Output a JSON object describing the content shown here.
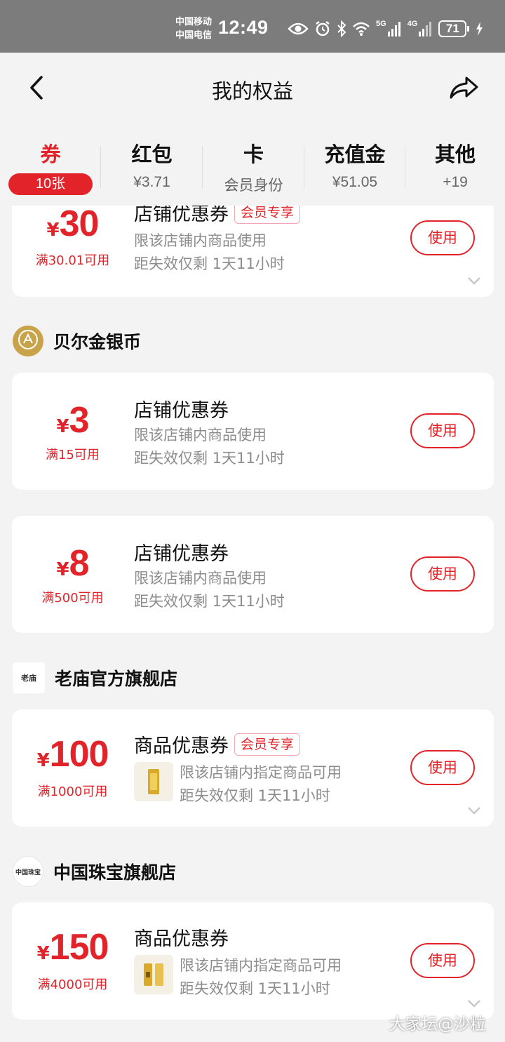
{
  "status_bar": {
    "carrier_1": "中国移动",
    "carrier_2": "中国电信",
    "time": "12:49",
    "signal_1": "5G",
    "signal_2": "4G",
    "battery": "71"
  },
  "header": {
    "title": "我的权益",
    "back_icon": "chevron-left-icon",
    "share_icon": "share-arrow-icon"
  },
  "tabs": [
    {
      "label": "券",
      "sub": "10张",
      "active": true
    },
    {
      "label": "红包",
      "sub": "¥3.71"
    },
    {
      "label": "卡",
      "sub": "会员身份"
    },
    {
      "label": "充值金",
      "sub": "¥51.05"
    },
    {
      "label": "其他",
      "sub": "+19"
    }
  ],
  "coupons": [
    {
      "yen": "¥",
      "amount": "30",
      "condition": "满30.01可用",
      "title": "店铺优惠券",
      "tag": "会员专享",
      "line1": "限该店铺内商品使用",
      "line2": "距失效仅剩 1天11小时",
      "button": "使用"
    },
    {
      "yen": "¥",
      "amount": "3",
      "condition": "满15可用",
      "title": "店铺优惠券",
      "line1": "限该店铺内商品使用",
      "line2": "距失效仅剩 1天11小时",
      "button": "使用"
    },
    {
      "yen": "¥",
      "amount": "8",
      "condition": "满500可用",
      "title": "店铺优惠券",
      "line1": "限该店铺内商品使用",
      "line2": "距失效仅剩 1天11小时",
      "button": "使用"
    },
    {
      "yen": "¥",
      "amount": "100",
      "condition": "满1000可用",
      "title": "商品优惠券",
      "tag": "会员专享",
      "line1": "限该店铺内指定商品可用",
      "line2": "距失效仅剩 1天11小时",
      "button": "使用"
    },
    {
      "yen": "¥",
      "amount": "150",
      "condition": "满4000可用",
      "title": "商品优惠券",
      "line1": "限该店铺内指定商品可用",
      "line2": "距失效仅剩 1天11小时",
      "button": "使用"
    }
  ],
  "stores": [
    {
      "name": "贝尔金银币"
    },
    {
      "name": "老庙官方旗舰店",
      "logo_text": "老庙"
    },
    {
      "name": "中国珠宝旗舰店",
      "logo_text": "中国珠宝"
    }
  ],
  "watermark": "大家坛@沙粒",
  "colors": {
    "accent": "#e2242a",
    "status_bar": "#7c7c7c",
    "page_bg": "#f3f3f3"
  }
}
